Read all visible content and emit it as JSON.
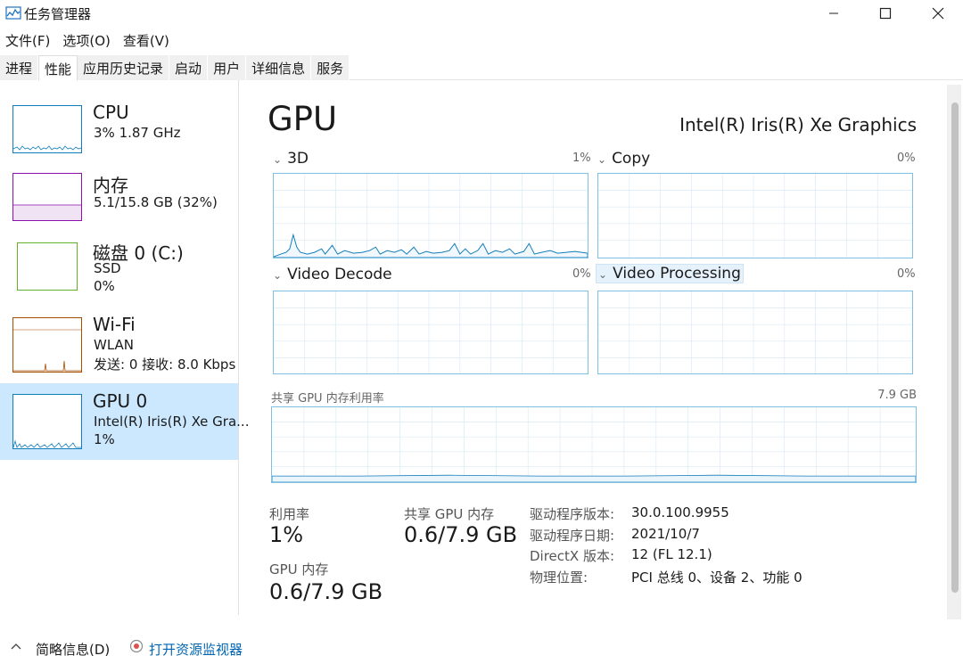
{
  "window": {
    "title": "任务管理器"
  },
  "menu": [
    "文件(F)",
    "选项(O)",
    "查看(V)"
  ],
  "tabs": [
    "进程",
    "性能",
    "应用历史记录",
    "启动",
    "用户",
    "详细信息",
    "服务"
  ],
  "active_tab": 1,
  "sidebar": {
    "items": [
      {
        "name": "CPU",
        "line1": "3% 1.87 GHz",
        "line2": "",
        "color": "#117dbb"
      },
      {
        "name": "内存",
        "line1": "5.1/15.8 GB (32%)",
        "line2": "",
        "color": "#8b12ae"
      },
      {
        "name": "磁盘 0 (C:)",
        "line1": "SSD",
        "line2": "0%",
        "color": "#4da60c"
      },
      {
        "name": "Wi-Fi",
        "line1": "WLAN",
        "line2": "发送: 0 接收: 8.0 Kbps",
        "color": "#a74f01"
      },
      {
        "name": "GPU 0",
        "line1": "Intel(R) Iris(R) Xe Gra...",
        "line2": "1%",
        "color": "#117dbb"
      }
    ],
    "selected": 4
  },
  "gpu": {
    "title": "GPU",
    "model": "Intel(R) Iris(R) Xe Graphics",
    "engines": [
      {
        "label": "3D",
        "pct": "1%"
      },
      {
        "label": "Copy",
        "pct": "0%"
      },
      {
        "label": "Video Decode",
        "pct": "0%"
      },
      {
        "label": "Video Processing",
        "pct": "0%"
      }
    ],
    "shared_memory_label": "共享 GPU 内存利用率",
    "shared_memory_max": "7.9 GB"
  },
  "stats": {
    "utilization_label": "利用率",
    "utilization_value": "1%",
    "shared_label": "共享 GPU 内存",
    "shared_value": "0.6/7.9 GB",
    "gpu_mem_label": "GPU 内存",
    "gpu_mem_value": "0.6/7.9 GB"
  },
  "info": [
    {
      "key": "驱动程序版本:",
      "value": "30.0.100.9955"
    },
    {
      "key": "驱动程序日期:",
      "value": "2021/10/7"
    },
    {
      "key": "DirectX 版本:",
      "value": "12 (FL 12.1)"
    },
    {
      "key": "物理位置:",
      "value": "PCI 总线 0、设备 2、功能 0"
    }
  ],
  "footer": {
    "fewer_details": "简略信息(D)",
    "open_resource_monitor": "打开资源监视器"
  },
  "colors": {
    "accent": "#117dbb",
    "selected_bg": "#cce8ff",
    "link": "#0066b4",
    "graph_border": "#7ec0e0"
  }
}
